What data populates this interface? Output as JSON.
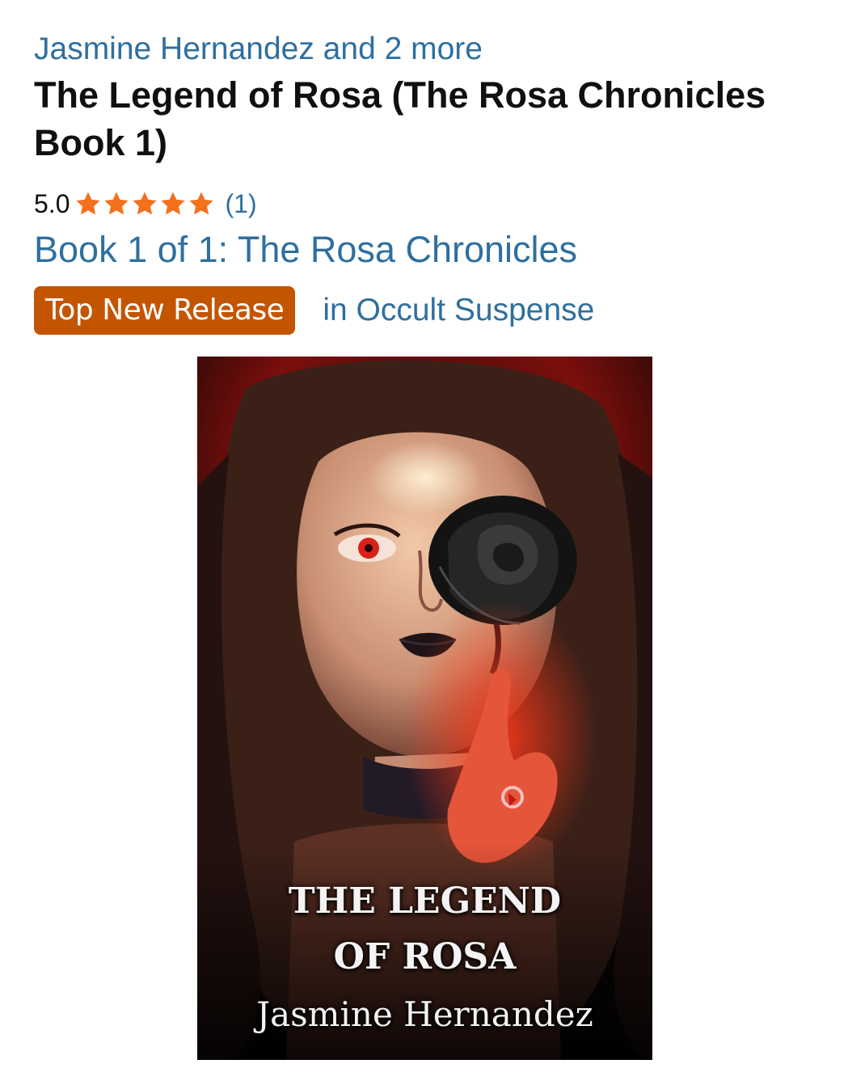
{
  "product": {
    "author_line": "Jasmine Hernandez and 2 more",
    "title": "The Legend of Rosa (The Rosa Chronicles Book 1)",
    "rating": {
      "value": "5.0",
      "stars_out_of_5": 5,
      "count": "(1)",
      "star_color": "#f3701d"
    },
    "series_link": "Book 1 of 1: The Rosa Chronicles",
    "badge": {
      "label": "Top New Release",
      "category": "in Occult Suspense",
      "color": "#c45500"
    },
    "cover": {
      "title_line_1": "THE LEGEND",
      "title_line_2": "OF ROSA",
      "author": "Jasmine Hernandez"
    }
  },
  "colors": {
    "link": "#2f6f9f",
    "text": "#0f1111"
  }
}
